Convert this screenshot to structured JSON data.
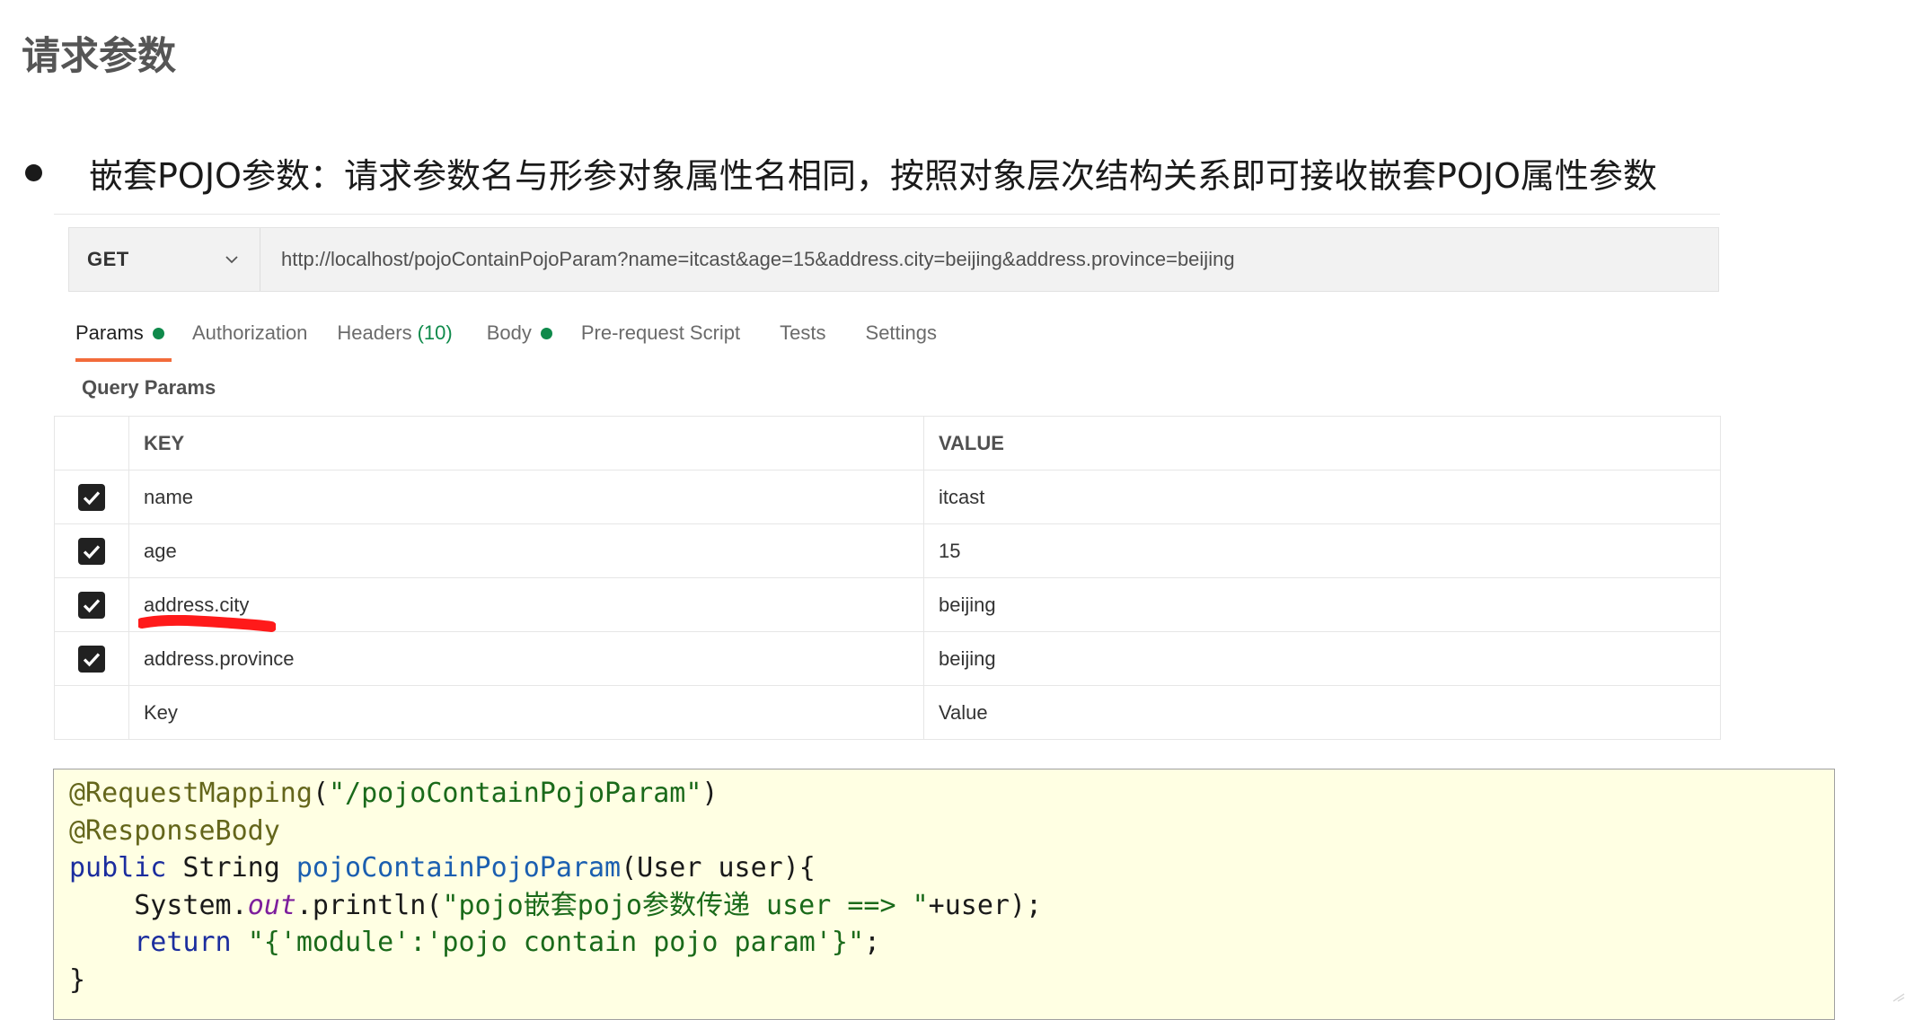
{
  "page": {
    "title": "请求参数",
    "bullet_text": "嵌套POJO参数：请求参数名与形参对象属性名相同，按照对象层次结构关系即可接收嵌套POJO属性参数"
  },
  "request": {
    "method": "GET",
    "url": "http://localhost/pojoContainPojoParam?name=itcast&age=15&address.city=beijing&address.province=beijing"
  },
  "tabs": [
    {
      "label": "Params",
      "active": true,
      "dot": true
    },
    {
      "label": "Authorization"
    },
    {
      "label": "Headers",
      "count": "(10)"
    },
    {
      "label": "Body",
      "dot": true
    },
    {
      "label": "Pre-request Script"
    },
    {
      "label": "Tests"
    },
    {
      "label": "Settings"
    }
  ],
  "query_params": {
    "label": "Query Params",
    "headers": {
      "key": "KEY",
      "value": "VALUE"
    },
    "rows": [
      {
        "key": "name",
        "value": "itcast",
        "checked": true
      },
      {
        "key": "age",
        "value": "15",
        "checked": true
      },
      {
        "key": "address.city",
        "value": "beijing",
        "checked": true
      },
      {
        "key": "address.province",
        "value": "beijing",
        "checked": true
      }
    ],
    "placeholder_key": "Key",
    "placeholder_value": "Value"
  },
  "code": {
    "lines": [
      [
        {
          "t": "@RequestMapping",
          "c": "anno"
        },
        {
          "t": "(",
          "c": "plain"
        },
        {
          "t": "\"/pojoContainPojoParam\"",
          "c": "str"
        },
        {
          "t": ")",
          "c": "plain"
        }
      ],
      [
        {
          "t": "@ResponseBody",
          "c": "anno"
        }
      ],
      [
        {
          "t": "public",
          "c": "kw"
        },
        {
          "t": " String ",
          "c": "plain"
        },
        {
          "t": "pojoContainPojoParam",
          "c": "mth"
        },
        {
          "t": "(User user){",
          "c": "plain"
        }
      ],
      [
        {
          "t": "    System.",
          "c": "plain"
        },
        {
          "t": "out",
          "c": "field"
        },
        {
          "t": ".println(",
          "c": "plain"
        },
        {
          "t": "\"pojo嵌套pojo参数传递 user ==> \"",
          "c": "str"
        },
        {
          "t": "+user);",
          "c": "plain"
        }
      ],
      [
        {
          "t": "    ",
          "c": "plain"
        },
        {
          "t": "return",
          "c": "kw"
        },
        {
          "t": " ",
          "c": "plain"
        },
        {
          "t": "\"{'module':'pojo contain pojo param'}\"",
          "c": "str"
        },
        {
          "t": ";",
          "c": "plain"
        }
      ],
      [
        {
          "t": "}",
          "c": "plain"
        }
      ]
    ]
  },
  "colors": {
    "tab_active_underline": "#f26b3a",
    "status_green": "#0f8a4b",
    "code_background": "#ffffe3",
    "annotation_mark": "#ff1a1a"
  },
  "icons": {
    "method_dropdown": "chevron-down-icon",
    "checkbox": "checkmark-icon"
  }
}
